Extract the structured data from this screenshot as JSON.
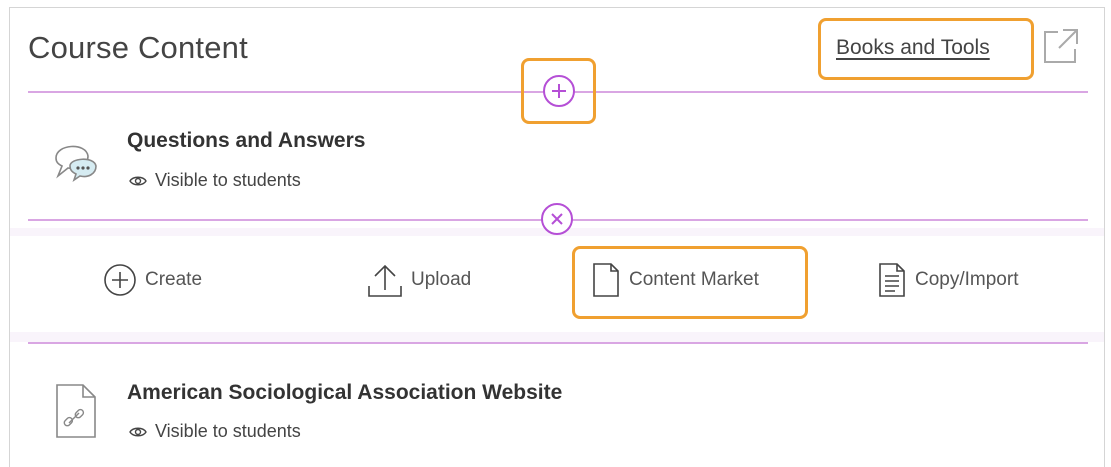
{
  "header": {
    "title": "Course Content",
    "books_link": "Books and Tools"
  },
  "content_items": [
    {
      "title": "Questions and Answers",
      "visibility": "Visible to students",
      "icon": "discussion-icon"
    },
    {
      "title": "American Sociological Association Website",
      "visibility": "Visible to students",
      "icon": "link-document-icon"
    }
  ],
  "add_menu": {
    "create_label": "Create",
    "upload_label": "Upload",
    "content_market_label": "Content Market",
    "copy_import_label": "Copy/Import"
  },
  "colors": {
    "accent": "#b54fd6",
    "divider": "#d9a6e3",
    "highlight": "#f0a030"
  }
}
